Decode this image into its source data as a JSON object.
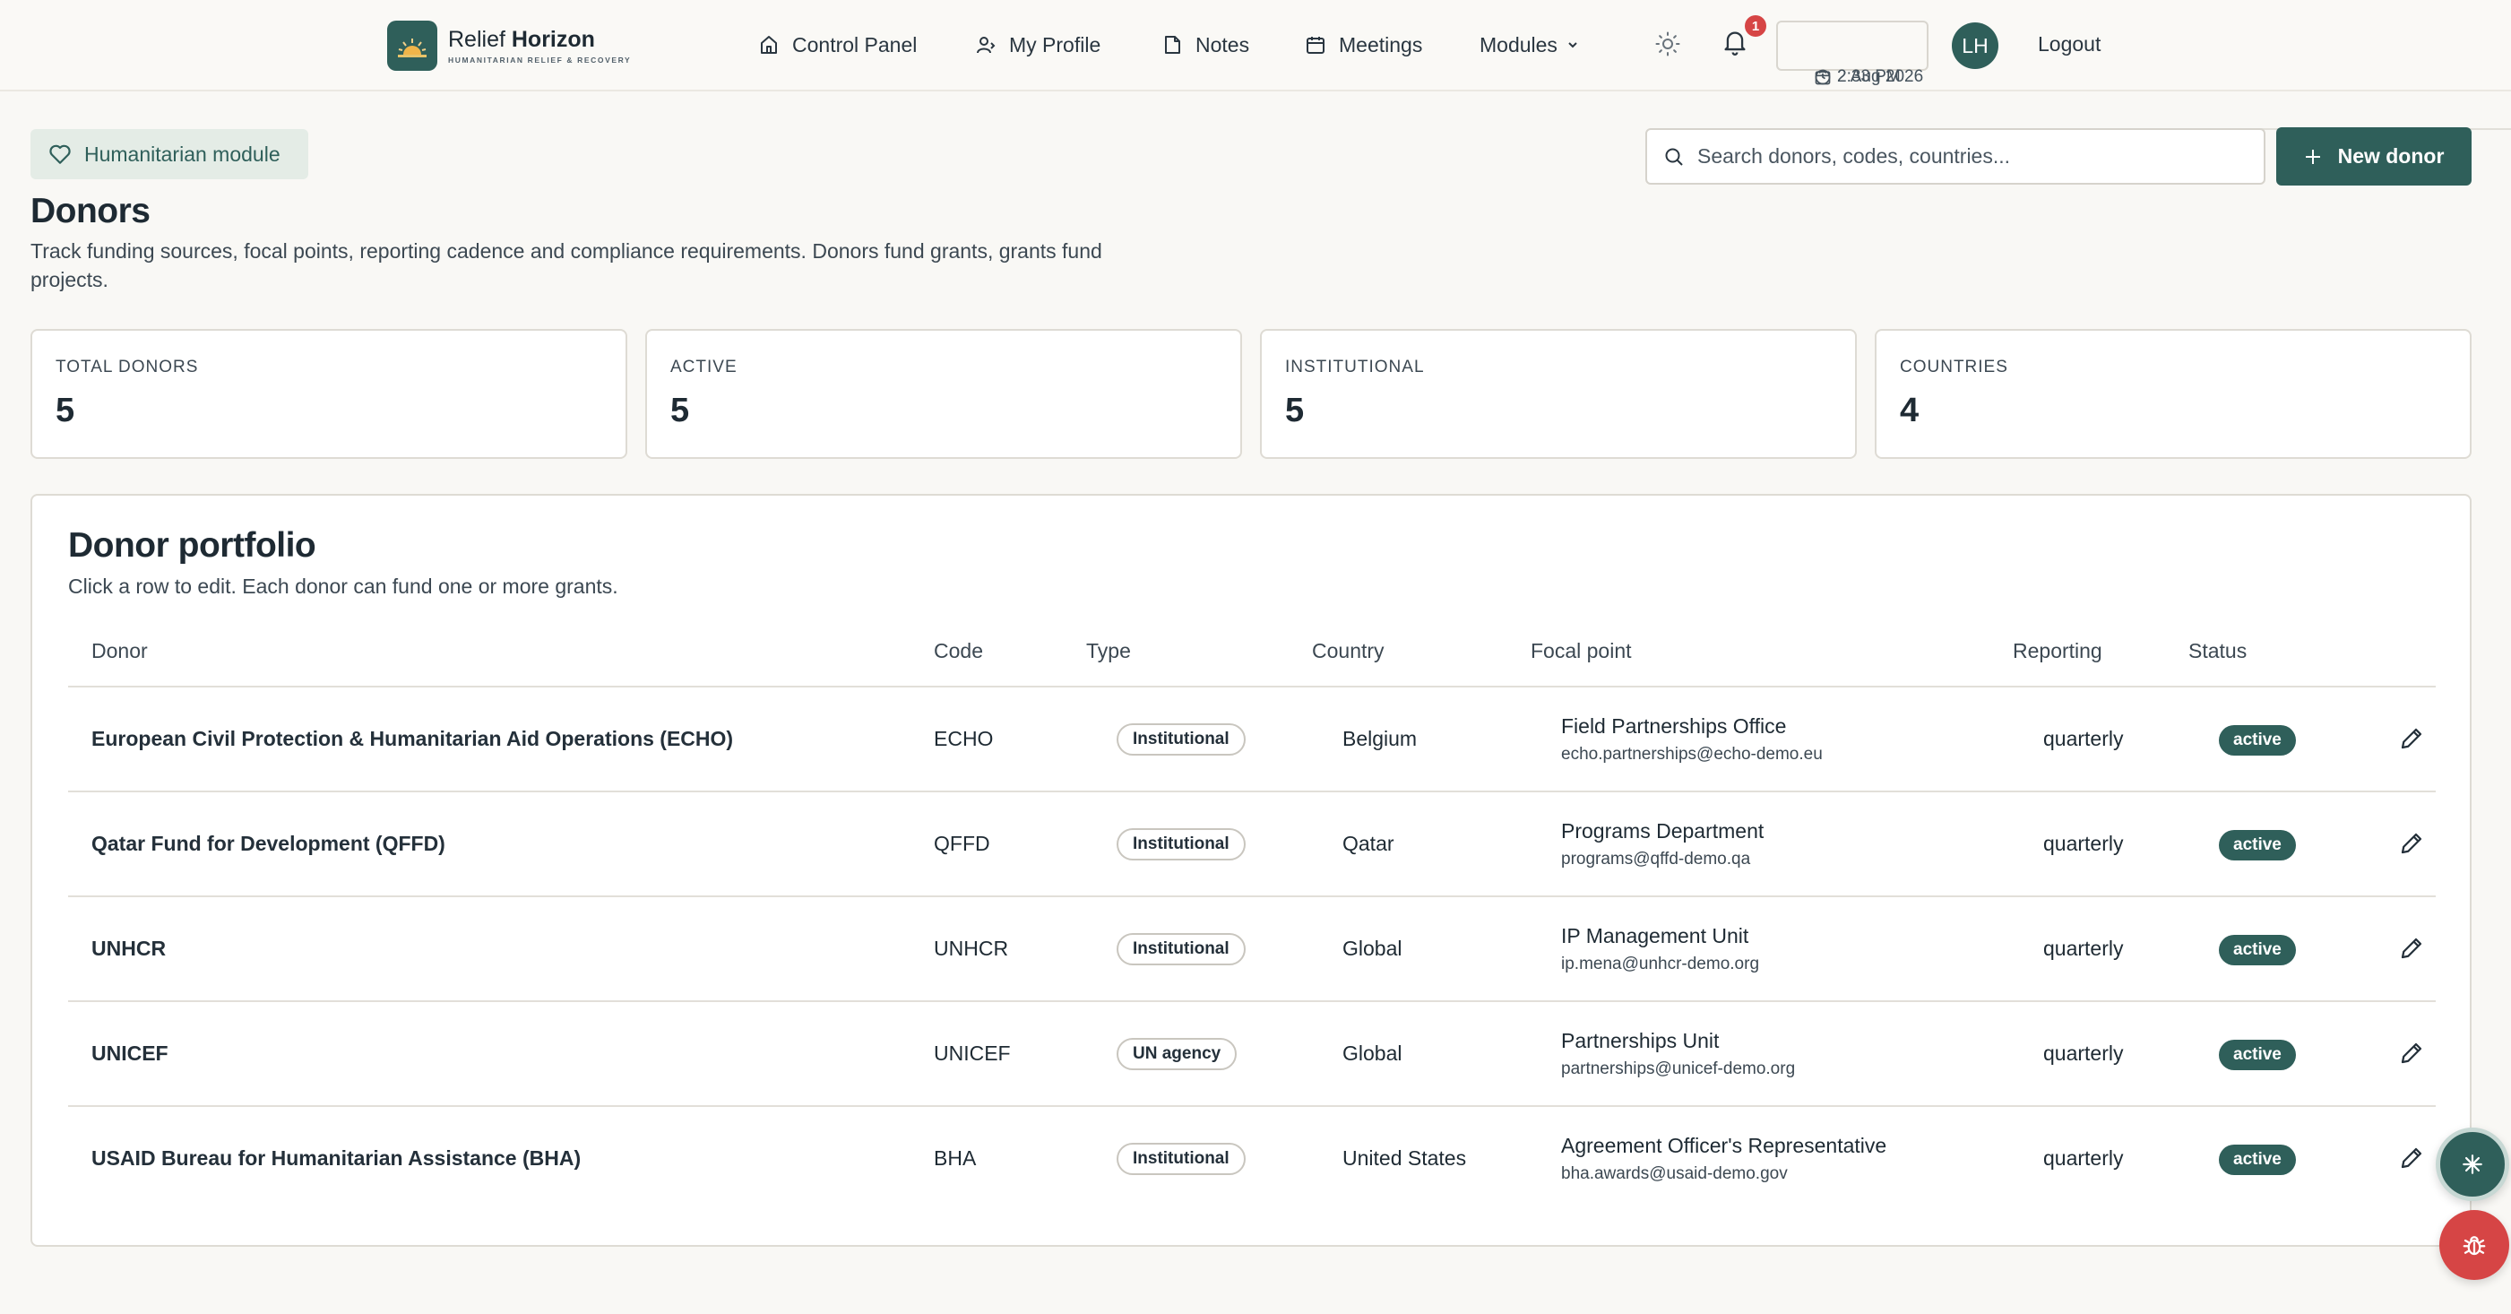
{
  "brand": {
    "name_part1": "Relief ",
    "name_part2": "Horizon",
    "tagline": "HUMANITARIAN RELIEF & RECOVERY"
  },
  "nav": {
    "items": [
      {
        "label": "Control Panel",
        "icon": "home-icon"
      },
      {
        "label": "My Profile",
        "icon": "user-icon"
      },
      {
        "label": "Notes",
        "icon": "note-icon"
      },
      {
        "label": "Meetings",
        "icon": "calendar-icon"
      },
      {
        "label": "Modules",
        "icon": "chevron-down-icon"
      }
    ],
    "notification_count": "1",
    "date": "2 Aug 2026",
    "time": "2:33 PM",
    "avatar_initials": "LH",
    "logout_label": "Logout"
  },
  "header": {
    "module_chip": "Humanitarian module",
    "title": "Donors",
    "subtitle": "Track funding sources, focal points, reporting cadence and compliance requirements. Donors fund grants, grants fund projects.",
    "search_placeholder": "Search donors, codes, countries...",
    "new_button_label": "New donor"
  },
  "stats": [
    {
      "label": "TOTAL DONORS",
      "value": "5"
    },
    {
      "label": "ACTIVE",
      "value": "5"
    },
    {
      "label": "INSTITUTIONAL",
      "value": "5"
    },
    {
      "label": "COUNTRIES",
      "value": "4"
    }
  ],
  "portfolio": {
    "title": "Donor portfolio",
    "subtitle": "Click a row to edit. Each donor can fund one or more grants.",
    "columns": [
      "Donor",
      "Code",
      "Type",
      "Country",
      "Focal point",
      "Reporting",
      "Status"
    ],
    "rows": [
      {
        "donor": "European Civil Protection & Humanitarian Aid Operations (ECHO)",
        "code": "ECHO",
        "type": "Institutional",
        "country": "Belgium",
        "focal": "Field Partnerships Office",
        "email": "echo.partnerships@echo-demo.eu",
        "reporting": "quarterly",
        "status": "active"
      },
      {
        "donor": "Qatar Fund for Development (QFFD)",
        "code": "QFFD",
        "type": "Institutional",
        "country": "Qatar",
        "focal": "Programs Department",
        "email": "programs@qffd-demo.qa",
        "reporting": "quarterly",
        "status": "active"
      },
      {
        "donor": "UNHCR",
        "code": "UNHCR",
        "type": "Institutional",
        "country": "Global",
        "focal": "IP Management Unit",
        "email": "ip.mena@unhcr-demo.org",
        "reporting": "quarterly",
        "status": "active"
      },
      {
        "donor": "UNICEF",
        "code": "UNICEF",
        "type": "UN agency",
        "country": "Global",
        "focal": "Partnerships Unit",
        "email": "partnerships@unicef-demo.org",
        "reporting": "quarterly",
        "status": "active"
      },
      {
        "donor": "USAID Bureau for Humanitarian Assistance (BHA)",
        "code": "BHA",
        "type": "Institutional",
        "country": "United States",
        "focal": "Agreement Officer's Representative",
        "email": "bha.awards@usaid-demo.gov",
        "reporting": "quarterly",
        "status": "active"
      }
    ]
  },
  "colors": {
    "accent": "#2f5f5a",
    "danger": "#d64545",
    "background": "#f9f8f5"
  }
}
